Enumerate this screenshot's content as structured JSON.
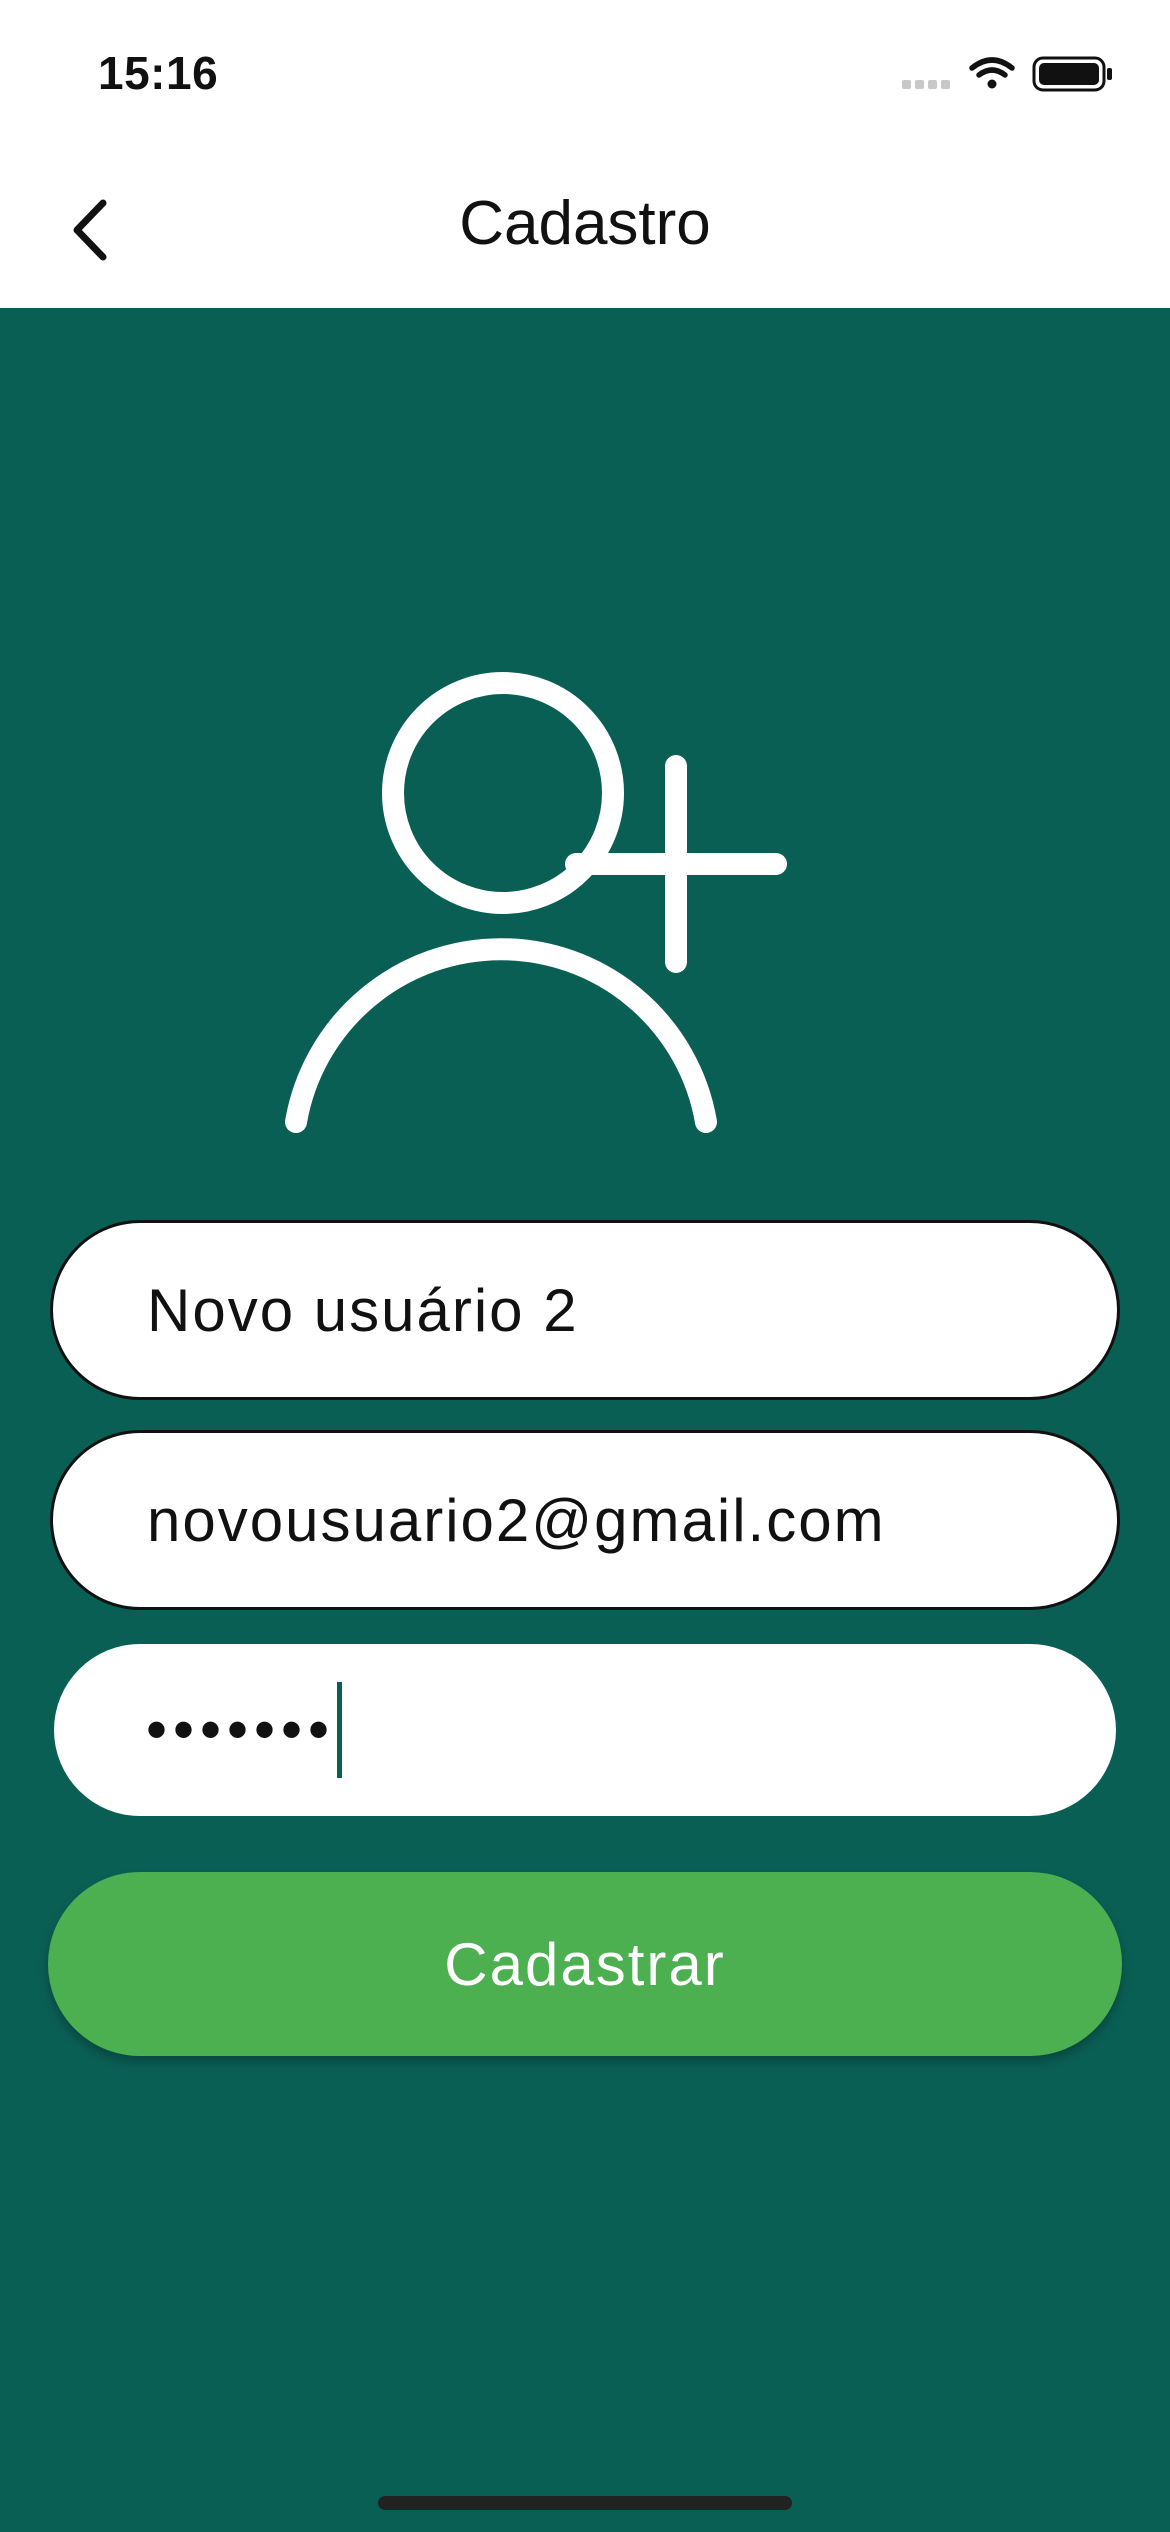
{
  "status_bar": {
    "time": "15:16",
    "signal_icon": "cellular-signal-icon",
    "wifi_icon": "wifi-icon",
    "battery_icon": "battery-icon"
  },
  "nav": {
    "title": "Cadastro",
    "back_icon": "chevron-left-icon"
  },
  "form": {
    "icon": "add-user-icon",
    "name_value": "Novo usuário 2",
    "email_value": "novousuario2@gmail.com",
    "password_value": "•••••••",
    "submit_label": "Cadastrar"
  },
  "colors": {
    "background": "#0a5f55",
    "button": "#4caf50",
    "field": "#ffffff"
  }
}
